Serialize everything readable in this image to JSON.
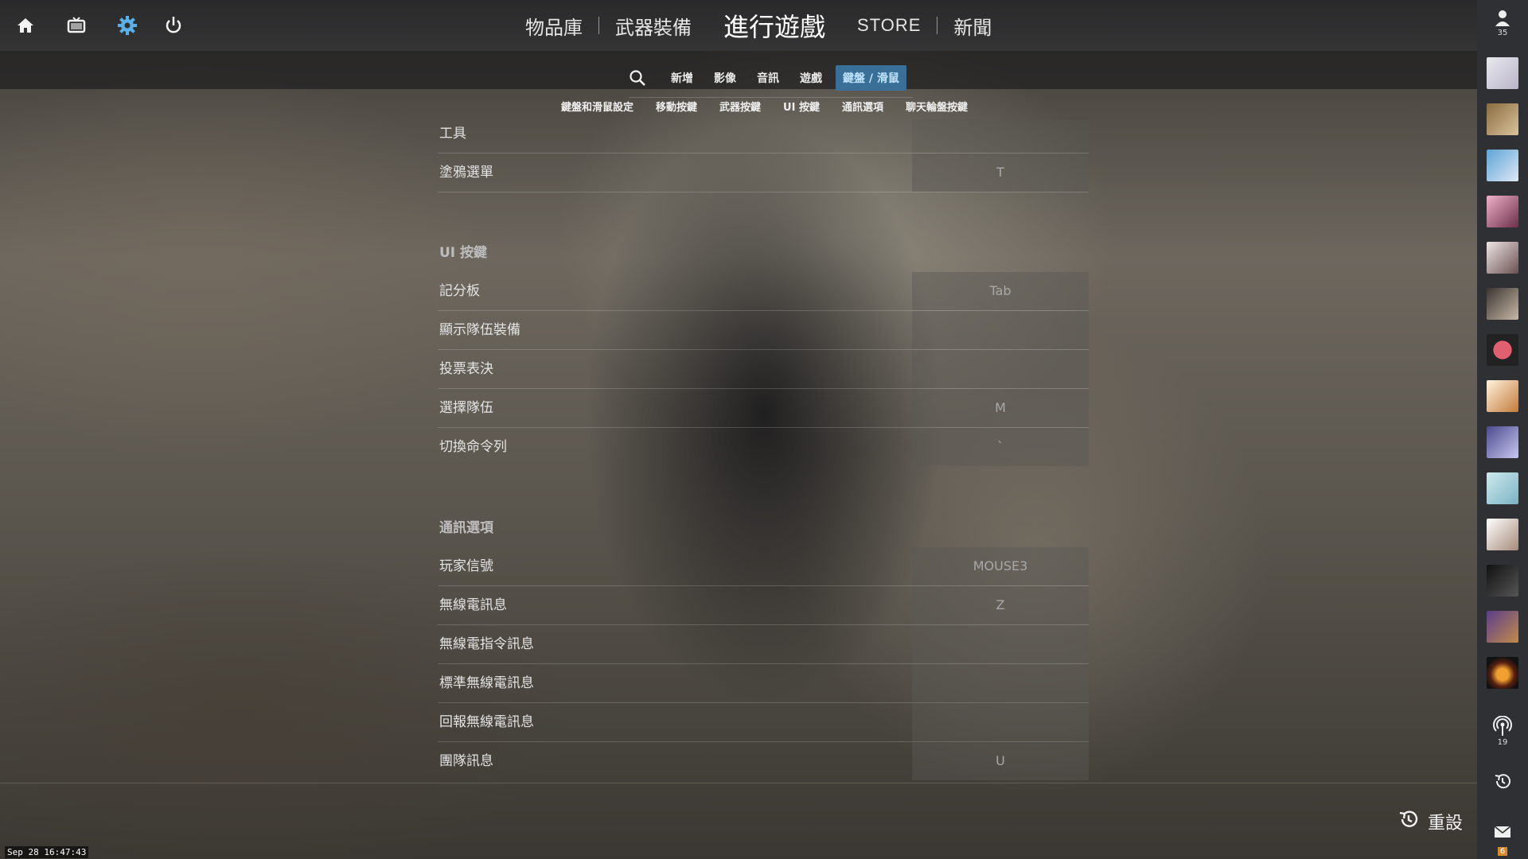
{
  "top_icons": [
    "home-icon",
    "tv-icon",
    "settings-gear-icon",
    "power-icon"
  ],
  "main_nav": {
    "inventory": "物品庫",
    "loadout": "武器裝備",
    "play": "進行遊戲",
    "store": "STORE",
    "news": "新聞"
  },
  "colors": {
    "accent": "#3a6f98",
    "accent_text": "#bfe3ff",
    "gear": "#5ab0e6",
    "badge": "#d8892c"
  },
  "sub_nav": {
    "tabs": [
      "新增",
      "影像",
      "音訊",
      "遊戲",
      "鍵盤 / 滑鼠"
    ],
    "active_index": 4
  },
  "section_nav": [
    "鍵盤和滑鼠設定",
    "移動按鍵",
    "武器按鍵",
    "UI 按鍵",
    "通訊選項",
    "聊天輪盤按鍵"
  ],
  "tools": {
    "label": "工具",
    "rows": [
      {
        "label": "塗鴉選單",
        "key": "T"
      }
    ]
  },
  "ui_keys": {
    "header": "UI 按鍵",
    "rows": [
      {
        "label": "記分板",
        "key": "Tab"
      },
      {
        "label": "顯示隊伍裝備",
        "key": ""
      },
      {
        "label": "投票表決",
        "key": ""
      },
      {
        "label": "選擇隊伍",
        "key": "M"
      },
      {
        "label": "切換命令列",
        "key": "`"
      }
    ]
  },
  "comm": {
    "header": "通訊選項",
    "rows": [
      {
        "label": "玩家信號",
        "key": "MOUSE3"
      },
      {
        "label": "無線電訊息",
        "key": "Z"
      },
      {
        "label": "無線電指令訊息",
        "key": ""
      },
      {
        "label": "標準無線電訊息",
        "key": ""
      },
      {
        "label": "回報無線電訊息",
        "key": ""
      },
      {
        "label": "團隊訊息",
        "key": "U"
      }
    ]
  },
  "reset_label": "重設",
  "clock": "Sep 28 16:47:43",
  "sidebar": {
    "friends_count": "35",
    "broadcast_count": "19",
    "mail_count": "6"
  }
}
